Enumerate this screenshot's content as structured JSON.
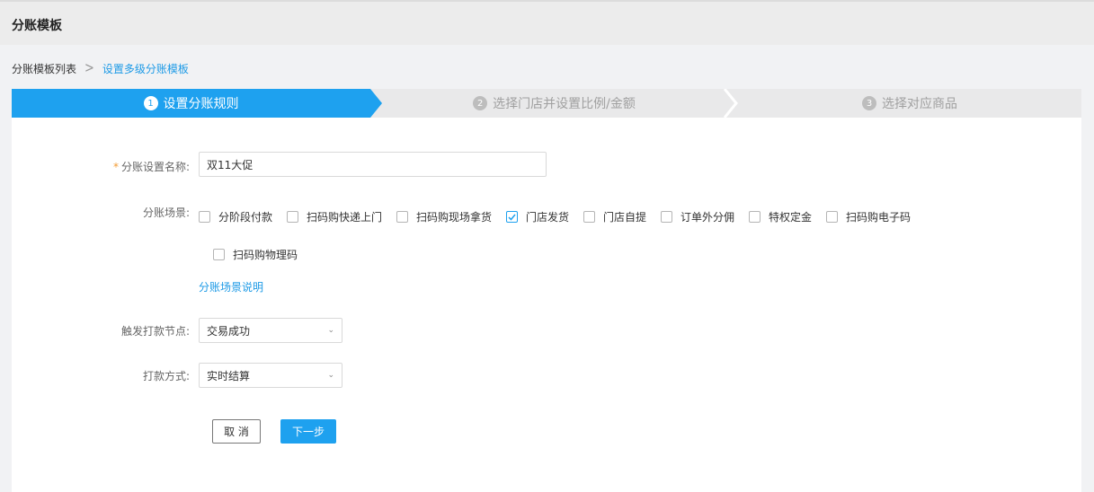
{
  "header": {
    "title": "分账模板"
  },
  "breadcrumb": {
    "parent": "分账模板列表",
    "separator": ">",
    "current": "设置多级分账模板"
  },
  "steps": [
    {
      "num": "1",
      "label": "设置分账规则",
      "active": true
    },
    {
      "num": "2",
      "label": "选择门店并设置比例/金额",
      "active": false
    },
    {
      "num": "3",
      "label": "选择对应商品",
      "active": false
    }
  ],
  "form": {
    "name_label": "分账设置名称:",
    "required_mark": "*",
    "name_value": "双11大促",
    "scene_label": "分账场景:",
    "scenes": [
      {
        "label": "分阶段付款",
        "checked": false
      },
      {
        "label": "扫码购快递上门",
        "checked": false
      },
      {
        "label": "扫码购现场拿货",
        "checked": false
      },
      {
        "label": "门店发货",
        "checked": true
      },
      {
        "label": "门店自提",
        "checked": false
      },
      {
        "label": "订单外分佣",
        "checked": false
      },
      {
        "label": "特权定金",
        "checked": false
      },
      {
        "label": "扫码购电子码",
        "checked": false
      },
      {
        "label": "扫码购物理码",
        "checked": false
      }
    ],
    "scene_help_link": "分账场景说明",
    "trigger_label": "触发打款节点:",
    "trigger_value": "交易成功",
    "payment_label": "打款方式:",
    "payment_value": "实时结算"
  },
  "actions": {
    "cancel": "取 消",
    "next": "下一步"
  },
  "colors": {
    "primary": "#1ea1ef",
    "required": "#f39c34",
    "link": "#1d9ae6"
  }
}
